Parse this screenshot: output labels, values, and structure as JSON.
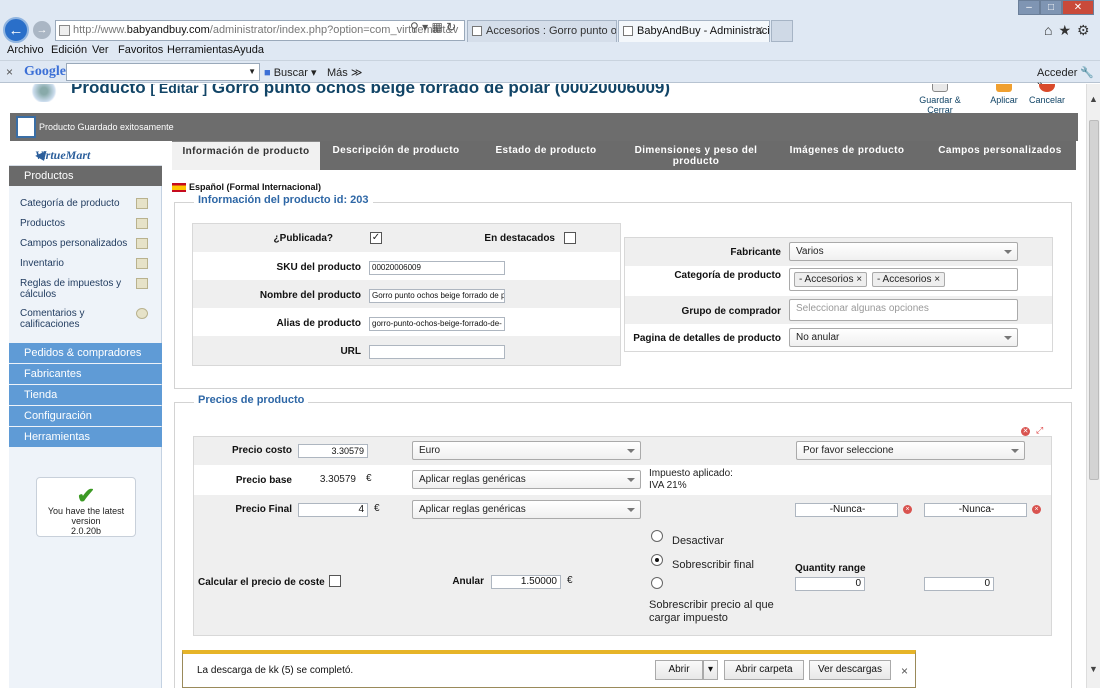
{
  "browser": {
    "url_prefix": "http://www.",
    "url_domain": "babyandbuy.com",
    "url_rest": "/administrator/index.php?option=com_virtuemart&v",
    "tabs": [
      {
        "label": "Accesorios : Gorro punto ocho..."
      },
      {
        "label": "BabyAndBuy - Administraci..."
      }
    ],
    "menu": [
      "Archivo",
      "Edición",
      "Ver",
      "Favoritos",
      "Herramientas",
      "Ayuda"
    ],
    "google": {
      "logo": "Google",
      "buscar": "Buscar",
      "mas": "Más ≫",
      "acceder": "Acceder"
    }
  },
  "header": {
    "title_main": "Producto",
    "title_edit": "[ Editar ]",
    "title_product": "Gorro punto ochos beige forrado de polar (00020006009)",
    "toolbar": {
      "save_close": "Guardar & Cerrar",
      "apply": "Aplicar",
      "cancel": "Cancelar"
    }
  },
  "message": "Producto Guardado exitosamente",
  "sidebar": {
    "logo": "VirtueMart",
    "section_products": "Productos",
    "items": [
      {
        "label": "Categoría de producto"
      },
      {
        "label": "Productos"
      },
      {
        "label": "Campos personalizados"
      },
      {
        "label": "Inventario"
      },
      {
        "label": "Reglas de impuestos y cálculos"
      },
      {
        "label": "Comentarios y calificaciones"
      }
    ],
    "sections": [
      "Pedidos & compradores",
      "Fabricantes",
      "Tienda",
      "Configuración",
      "Herramientas"
    ],
    "version_text": "You have the latest version",
    "version_number": "2.0.20b"
  },
  "content": {
    "tabs": [
      {
        "label": "Información de producto"
      },
      {
        "label": "Descripción de producto"
      },
      {
        "label": "Estado de producto"
      },
      {
        "label": "Dimensiones y peso del producto"
      },
      {
        "label": "Imágenes de producto"
      },
      {
        "label": "Campos personalizados"
      }
    ],
    "language": "Español (Formal Internacional)",
    "info_legend": "Información del producto id: 203",
    "published_label": "¿Publicada?",
    "published": true,
    "featured_label": "En destacados",
    "featured": false,
    "sku_label": "SKU del producto",
    "sku_value": "00020006009",
    "name_label": "Nombre del producto",
    "name_value": "Gorro punto ochos beige forrado de p",
    "alias_label": "Alias de producto",
    "alias_value": "gorro-punto-ochos-beige-forrado-de-",
    "url_label": "URL",
    "url_value": "",
    "manufacturer_label": "Fabricante",
    "manufacturer_value": "Varios",
    "category_label": "Categoría de producto",
    "categories": [
      "- Accesorios",
      "- Accesorios"
    ],
    "shoppergroup_label": "Grupo de comprador",
    "shoppergroup_placeholder": "Seleccionar algunas opciones",
    "detailpage_label": "Pagina de detalles de producto",
    "detailpage_value": "No anular",
    "prices_legend": "Precios de producto",
    "cost_label": "Precio costo",
    "cost_value": "3.30579",
    "currency_value": "Euro",
    "shopper_select": "Por favor seleccione",
    "base_label": "Precio base",
    "base_value": "3.30579",
    "euro": "€",
    "rules_value": "Aplicar reglas genéricas",
    "tax_applied": "Impuesto aplicado:",
    "tax_rate": "IVA 21%",
    "final_label": "Precio Final",
    "final_value": "4",
    "never_from": "-Nunca-",
    "never_to": "-Nunca-",
    "deactivate": "Desactivar",
    "overwrite_final": "Sobrescribir final",
    "overwrite_price": "Sobrescribir precio al que cargar impuesto",
    "calc_cost_label": "Calcular el precio de coste",
    "override_label": "Anular",
    "override_value": "1.50000",
    "quantity_range_label": "Quantity range",
    "qty_from": "0",
    "qty_to": "0"
  },
  "download": {
    "text": "La descarga de kk (5) se completó.",
    "open": "Abrir",
    "open_folder": "Abrir carpeta",
    "view_downloads": "Ver descargas"
  }
}
